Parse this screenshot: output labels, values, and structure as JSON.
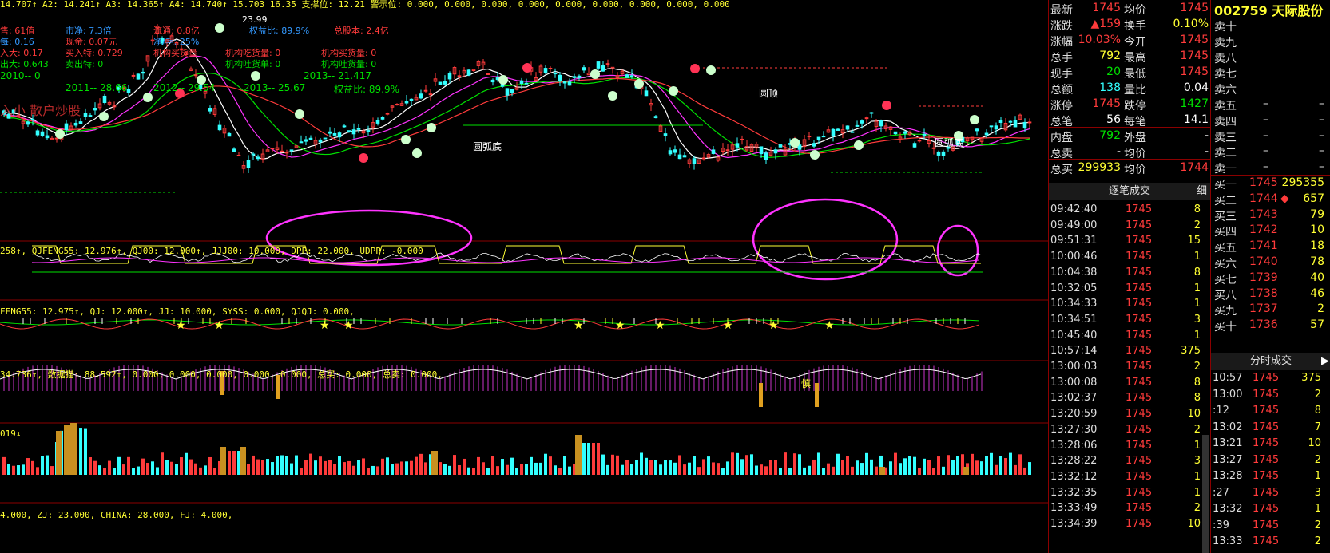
{
  "colors": {
    "red": "#ff3b3b",
    "green": "#00e000",
    "yellow": "#ffff33",
    "magenta": "#ff33ff",
    "cyan": "#33ffff",
    "white": "#ffffff"
  },
  "stock": {
    "code": "002759",
    "name": "天际股份"
  },
  "top_strip": "14.707↑  A2: 14.241↑  A3: 14.365↑  A4: 14.740↑  15.703  16.35  支撑位: 12.21  警示位: 0.000, 0.000, 0.000, 0.000, 0.000, 0.000, 0.000, 0.000, 0.000",
  "info_block": [
    {
      "text": "售: 61值",
      "color": "#ff3b3b"
    },
    {
      "text": "市净: 7.3倍",
      "color": "#3399ff"
    },
    {
      "text": "流通: 0.8亿",
      "color": "#ff3b3b"
    },
    {
      "text": "权益比: 89.9%",
      "color": "#3399ff"
    },
    {
      "text": "总股本: 2.4亿",
      "color": "#ff3b3b"
    },
    {
      "text": "每: 0.16",
      "color": "#3399ff"
    },
    {
      "text": "现金: 0.07元",
      "color": "#ff3b3b"
    },
    {
      "text": "净/毛: 25%",
      "color": "#3399ff"
    },
    {
      "text": "入大: 0.17",
      "color": "#ff3b3b"
    },
    {
      "text": "买入特: 0.729",
      "color": "#ff3b3b"
    },
    {
      "text": "机构买货量",
      "color": "#ff3b3b"
    },
    {
      "text": "机构吃货量: 0",
      "color": "#ff3b3b"
    },
    {
      "text": "机构买货量: 0",
      "color": "#ff3b3b"
    },
    {
      "text": "出大: 0.643",
      "color": "#00e000"
    },
    {
      "text": "卖出特: 0",
      "color": "#00e000"
    },
    {
      "text": "机构吐货单: 0",
      "color": "#00e000"
    },
    {
      "text": "机构吐货量: 0",
      "color": "#00e000"
    },
    {
      "text": "2010-- 0",
      "color": "#00e000"
    },
    {
      "text": "2011-- 28.66",
      "color": "#00e000"
    },
    {
      "text": "2012-- 29.54",
      "color": "#00e000"
    },
    {
      "text": "2013-- 25.67",
      "color": "#00e000"
    },
    {
      "text": "2013-- 21.417",
      "color": "#00e000"
    },
    {
      "text": "权益比: 89.9%",
      "color": "#00e000"
    },
    {
      "text": "入小 散户炒股",
      "color": "#ff3b3b"
    }
  ],
  "chart_labels": {
    "arc_bottom_1": "圆弧底",
    "arc_bottom_2": "圆弧底",
    "round_top": "圆顶",
    "price_high": "23.99",
    "cautious": "慎"
  },
  "panel2": "258↑, QJFENG55: 12.976↑, QJ00: 12.000↑, JJJ00: 10.000, DPP: 22.000, UDPP: -0.000",
  "panel3": "FENG55: 12.975↑, QJ: 12.000↑, JJ: 10.000, SYSS: 0.000, QJQJ: 0.000,",
  "panel4": "34.736↑, 数据猫: 88.592↑, 0.000, 0.000, 0.000, 0.000, 0.000, 总买: 0.000, 总卖: 0.000,",
  "panel5": "019↓",
  "panel6": "4.000, ZJ: 23.000, CHINA: 28.000, FJ: 4.000,",
  "quote": [
    {
      "l": "最新",
      "v": "1745",
      "vc": "red",
      "l2": "均价",
      "v2": "1745",
      "v2c": "red"
    },
    {
      "l": "涨跌",
      "v": "▲159",
      "vc": "red",
      "l2": "换手",
      "v2": "0.10%",
      "v2c": "yellow"
    },
    {
      "l": "涨幅",
      "v": "10.03%",
      "vc": "red",
      "l2": "今开",
      "v2": "1745",
      "v2c": "red"
    },
    {
      "l": "总手",
      "v": "792",
      "vc": "yellow",
      "l2": "最高",
      "v2": "1745",
      "v2c": "red"
    },
    {
      "l": "现手",
      "v": "20",
      "vc": "green",
      "l2": "最低",
      "v2": "1745",
      "v2c": "red"
    },
    {
      "l": "总额",
      "v": "138",
      "vc": "cyan",
      "l2": "量比",
      "v2": "0.04",
      "v2c": "white"
    },
    {
      "l": "涨停",
      "v": "1745",
      "vc": "red",
      "l2": "跌停",
      "v2": "1427",
      "v2c": "green"
    },
    {
      "l": "总笔",
      "v": "56",
      "vc": "white",
      "l2": "每笔",
      "v2": "14.1",
      "v2c": "white"
    },
    {
      "l": "内盘",
      "v": "792",
      "vc": "green",
      "l2": "外盘",
      "v2": "-",
      "v2c": "white"
    },
    {
      "l": "总卖",
      "v": "-",
      "vc": "white",
      "l2": "均价",
      "v2": "-",
      "v2c": "white"
    },
    {
      "l": "总买",
      "v": "299933",
      "vc": "yellow",
      "l2": "均价",
      "v2": "1744",
      "v2c": "red"
    }
  ],
  "tick_header": {
    "title": "逐笔成交",
    "detail": "细"
  },
  "ticks": [
    {
      "t": "09:42:40",
      "p": "1745",
      "v": "8"
    },
    {
      "t": "09:49:00",
      "p": "1745",
      "v": "2"
    },
    {
      "t": "09:51:31",
      "p": "1745",
      "v": "15"
    },
    {
      "t": "10:00:46",
      "p": "1745",
      "v": "1"
    },
    {
      "t": "10:04:38",
      "p": "1745",
      "v": "8"
    },
    {
      "t": "10:32:05",
      "p": "1745",
      "v": "1"
    },
    {
      "t": "10:34:33",
      "p": "1745",
      "v": "1"
    },
    {
      "t": "10:34:51",
      "p": "1745",
      "v": "3"
    },
    {
      "t": "10:45:40",
      "p": "1745",
      "v": "1"
    },
    {
      "t": "10:57:14",
      "p": "1745",
      "v": "375"
    },
    {
      "t": "13:00:03",
      "p": "1745",
      "v": "2"
    },
    {
      "t": "13:00:08",
      "p": "1745",
      "v": "8"
    },
    {
      "t": "13:02:37",
      "p": "1745",
      "v": "8"
    },
    {
      "t": "13:20:59",
      "p": "1745",
      "v": "10"
    },
    {
      "t": "13:27:30",
      "p": "1745",
      "v": "2"
    },
    {
      "t": "13:28:06",
      "p": "1745",
      "v": "1"
    },
    {
      "t": "13:28:22",
      "p": "1745",
      "v": "3"
    },
    {
      "t": "13:32:12",
      "p": "1745",
      "v": "1"
    },
    {
      "t": "13:32:35",
      "p": "1745",
      "v": "1"
    },
    {
      "t": "13:33:49",
      "p": "1745",
      "v": "2"
    },
    {
      "t": "13:34:39",
      "p": "1745",
      "v": "10"
    }
  ],
  "sell_book": [
    {
      "l": "卖十",
      "p": "",
      "v": ""
    },
    {
      "l": "卖九",
      "p": "",
      "v": ""
    },
    {
      "l": "卖八",
      "p": "",
      "v": ""
    },
    {
      "l": "卖七",
      "p": "",
      "v": ""
    },
    {
      "l": "卖六",
      "p": "",
      "v": ""
    },
    {
      "l": "卖五",
      "p": "–",
      "v": "–"
    },
    {
      "l": "卖四",
      "p": "–",
      "v": "–"
    },
    {
      "l": "卖三",
      "p": "–",
      "v": "–"
    },
    {
      "l": "卖二",
      "p": "–",
      "v": "–"
    },
    {
      "l": "卖一",
      "p": "–",
      "v": "–"
    }
  ],
  "buy_book": [
    {
      "l": "买一",
      "p": "1745",
      "v": "295355",
      "mark": ""
    },
    {
      "l": "买二",
      "p": "1744",
      "v": "657",
      "mark": "◆"
    },
    {
      "l": "买三",
      "p": "1743",
      "v": "79",
      "mark": ""
    },
    {
      "l": "买四",
      "p": "1742",
      "v": "10",
      "mark": ""
    },
    {
      "l": "买五",
      "p": "1741",
      "v": "18",
      "mark": ""
    },
    {
      "l": "买六",
      "p": "1740",
      "v": "78",
      "mark": ""
    },
    {
      "l": "买七",
      "p": "1739",
      "v": "40",
      "mark": ""
    },
    {
      "l": "买八",
      "p": "1738",
      "v": "46",
      "mark": ""
    },
    {
      "l": "买九",
      "p": "1737",
      "v": "2",
      "mark": ""
    },
    {
      "l": "买十",
      "p": "1736",
      "v": "57",
      "mark": ""
    }
  ],
  "minute_header": "分时成交",
  "minute_ticks": [
    {
      "t": "10:57",
      "p": "1745",
      "v": "375"
    },
    {
      "t": "13:00",
      "p": "1745",
      "v": "2"
    },
    {
      "t": ":12",
      "p": "1745",
      "v": "8"
    },
    {
      "t": "13:02",
      "p": "1745",
      "v": "7"
    },
    {
      "t": "13:21",
      "p": "1745",
      "v": "10"
    },
    {
      "t": "13:27",
      "p": "1745",
      "v": "2"
    },
    {
      "t": "13:28",
      "p": "1745",
      "v": "1"
    },
    {
      "t": ":27",
      "p": "1745",
      "v": "3"
    },
    {
      "t": "13:32",
      "p": "1745",
      "v": "1"
    },
    {
      "t": ":39",
      "p": "1745",
      "v": "2"
    },
    {
      "t": "13:33",
      "p": "1745",
      "v": "2"
    }
  ]
}
